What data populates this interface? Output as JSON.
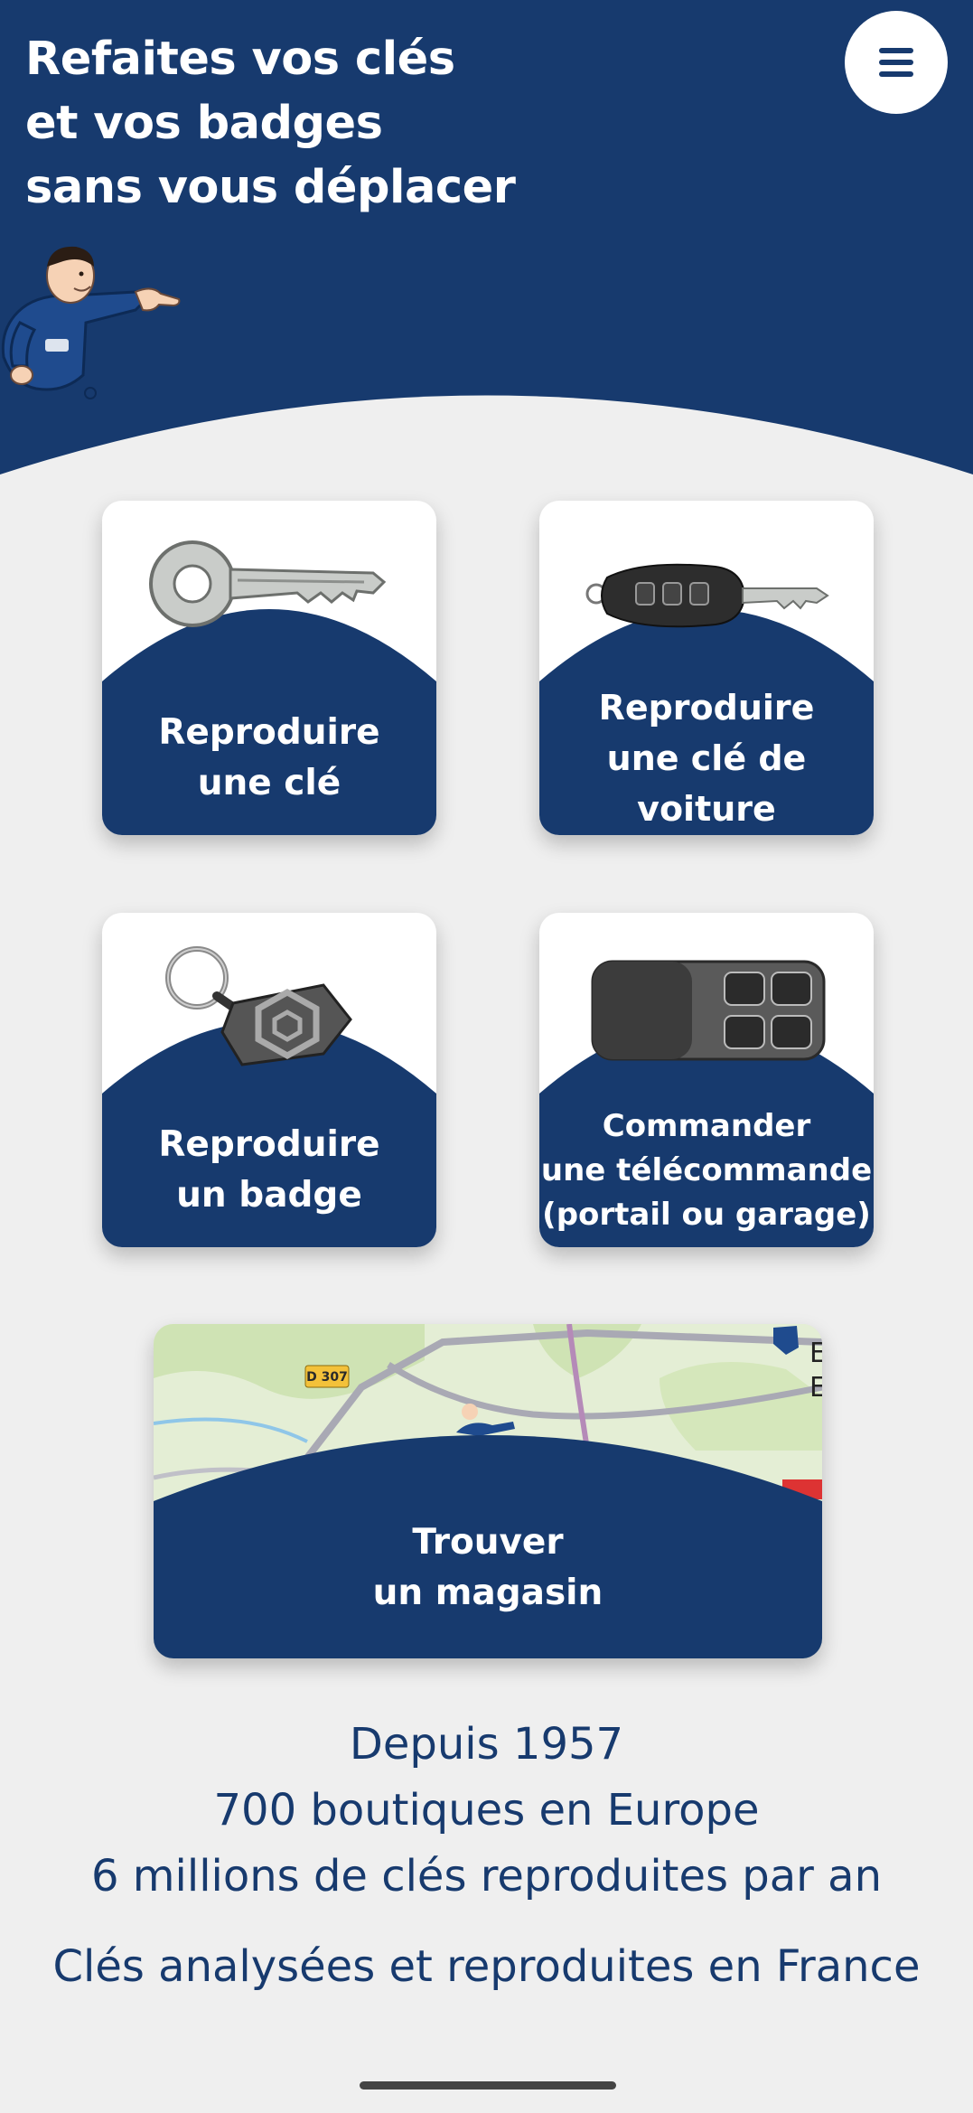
{
  "header": {
    "title_lines": [
      "Refaites vos clés",
      "et vos badges",
      "sans vous déplacer"
    ],
    "menu_icon": "hamburger-icon"
  },
  "colors": {
    "brand_navy": "#173a6e",
    "background": "#efefef",
    "card": "#ffffff"
  },
  "cards": [
    {
      "lines": [
        "Reproduire",
        "une clé"
      ],
      "icon": "house-key-image"
    },
    {
      "lines": [
        "Reproduire",
        "une clé de voiture"
      ],
      "icon": "car-key-image"
    },
    {
      "lines": [
        "Reproduire",
        "un badge"
      ],
      "icon": "badge-fob-image"
    },
    {
      "lines": [
        "Commander",
        "une télécommande",
        "(portail ou garage)"
      ],
      "icon": "gate-remote-image"
    }
  ],
  "store_card": {
    "lines": [
      "Trouver",
      "un magasin"
    ],
    "map_road_label": "D 307",
    "map_edge_letters": [
      "E",
      "E"
    ]
  },
  "stats": [
    "Depuis 1957",
    "700 boutiques en Europe",
    "6 millions de clés reproduites par an"
  ],
  "origin": "Clés analysées et reproduites en France"
}
